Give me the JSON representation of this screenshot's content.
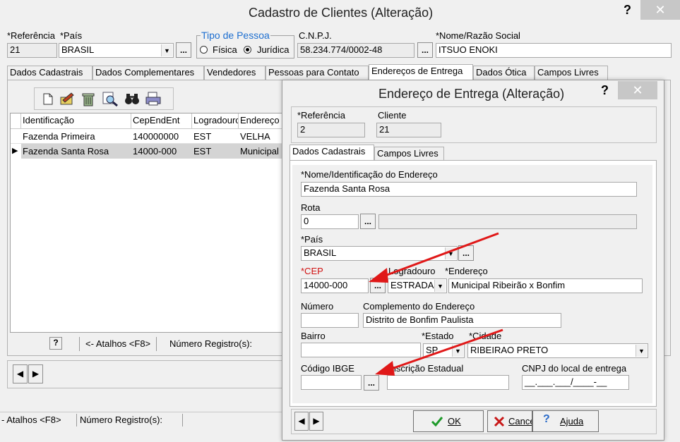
{
  "main_window": {
    "title": "Cadastro de Clientes (Alteração)",
    "help_glyph": "?",
    "close_glyph": "✕",
    "referencia_label": "*Referência",
    "referencia_value": "21",
    "pais_label": "*País",
    "pais_value": "BRASIL",
    "tipo_pessoa_label": "Tipo de Pessoa",
    "fisica_label": "Física",
    "juridica_label": "Jurídica",
    "cnpj_label": "C.N.P.J.",
    "cnpj_value": "58.234.774/0002-48",
    "nome_label": "*Nome/Razão Social",
    "nome_value": "ITSUO ENOKI",
    "dots_label": "...",
    "tabs": [
      "Dados Cadastrais",
      "Dados Complementares",
      "Vendedores",
      "Pessoas para Contato",
      "Endereços de Entrega",
      "Dados Ótica",
      "Campos Livres"
    ],
    "grid": {
      "headers": [
        "Identificação",
        "CepEndEnt",
        "Logradouro",
        "Endereço"
      ],
      "rows": [
        [
          "Fazenda Primeira",
          "140000000",
          "EST",
          "VELHA"
        ],
        [
          "Fazenda Santa Rosa",
          "14000-000",
          "EST",
          "Municipal"
        ]
      ],
      "current_row_marker": "▶"
    },
    "shortcut_help": "?",
    "atalhos_label": "<- Atalhos <F8>",
    "num_registros_label": "Número Registro(s):",
    "nav_prev": "◀",
    "nav_next": "▶",
    "status_atalhos": "- Atalhos <F8>",
    "status_num_registros": "Número Registro(s):"
  },
  "dialog": {
    "title": "Endereço de Entrega (Alteração)",
    "help_glyph": "?",
    "close_glyph": "✕",
    "referencia_label": "*Referência",
    "referencia_value": "2",
    "cliente_label": "Cliente",
    "cliente_value": "21",
    "tabs": [
      "Dados Cadastrais",
      "Campos Livres"
    ],
    "nome_label": "*Nome/Identificação do Endereço",
    "nome_value": "Fazenda Santa Rosa",
    "rota_label": "Rota",
    "rota_value": "0",
    "rota_desc_value": "",
    "pais_label": "*País",
    "pais_value": "BRASIL",
    "cep_label": "*CEP",
    "cep_value": "14000-000",
    "logradouro_label": "Logradouro",
    "logradouro_value": "ESTRADA",
    "endereco_label": "*Endereço",
    "endereco_value": "Municipal Ribeirão x Bonfim",
    "numero_label": "Número",
    "numero_value": "",
    "complemento_label": "Complemento do Endereço",
    "complemento_value": "Distrito de Bonfim Paulista",
    "bairro_label": "Bairro",
    "bairro_value": "",
    "estado_label": "*Estado",
    "estado_value": "SP",
    "cidade_label": "*Cidade",
    "cidade_value": "RIBEIRAO PRETO",
    "ibge_label": "Código IBGE",
    "ibge_value": "",
    "inscricao_label": "Inscrição Estadual",
    "inscricao_value": "",
    "cnpj_local_label": "CNPJ do local de entrega",
    "cnpj_local_value": "__.___.___/____-__",
    "dots_label": "...",
    "ok_label": "OK",
    "cancel_label": "Cancelar",
    "ajuda_label": "Ajuda",
    "nav_prev": "◀",
    "nav_next": "▶"
  },
  "colors": {
    "required_label": "#d01010",
    "group_title": "#1e6fd0",
    "arrow": "#e01818",
    "window_bg": "#f0f0f0"
  }
}
